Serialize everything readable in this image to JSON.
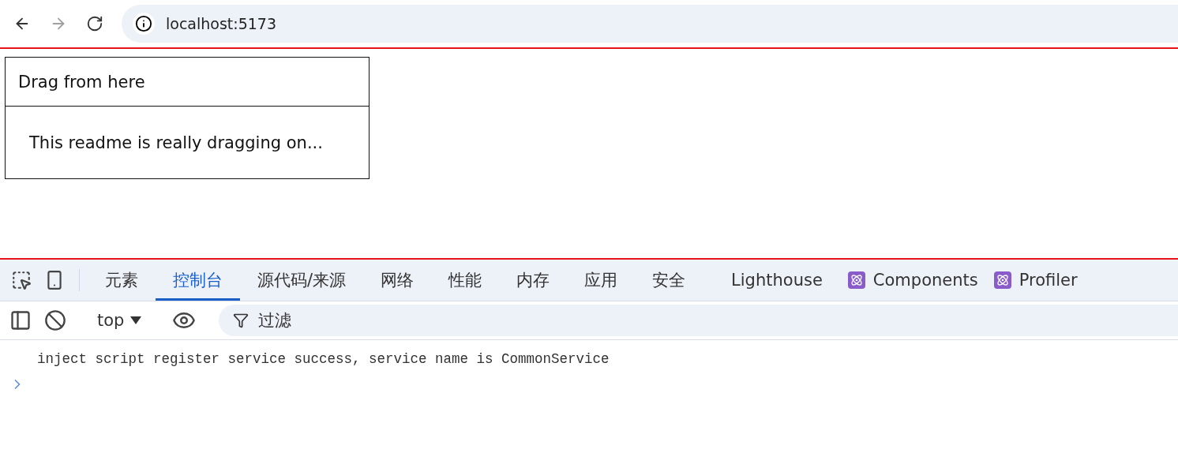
{
  "browser": {
    "nav": [
      {
        "kind": "back",
        "disabled": false
      },
      {
        "kind": "forward",
        "disabled": true
      },
      {
        "kind": "reload",
        "disabled": false
      }
    ],
    "address": "localhost:5173"
  },
  "page": {
    "card": {
      "header": "Drag from here",
      "body": "This readme is really dragging on..."
    }
  },
  "devtools": {
    "tabs": [
      {
        "label": "元素",
        "kind": "plain",
        "selected": false
      },
      {
        "label": "控制台",
        "kind": "plain",
        "selected": true
      },
      {
        "label": "源代码/来源",
        "kind": "plain",
        "selected": false
      },
      {
        "label": "网络",
        "kind": "plain",
        "selected": false
      },
      {
        "label": "性能",
        "kind": "plain",
        "selected": false
      },
      {
        "label": "内存",
        "kind": "plain",
        "selected": false
      },
      {
        "label": "应用",
        "kind": "plain",
        "selected": false
      },
      {
        "label": "安全",
        "kind": "plain",
        "selected": false
      },
      {
        "label": "Lighthouse",
        "kind": "plain",
        "selected": false
      },
      {
        "label": "Components",
        "kind": "react",
        "selected": false
      },
      {
        "label": "Profiler",
        "kind": "react",
        "selected": false
      }
    ],
    "console_toolbar": {
      "context": "top",
      "filter": {
        "placeholder": "过滤"
      }
    },
    "messages": [
      "inject script register service success, service name is CommonService"
    ]
  }
}
